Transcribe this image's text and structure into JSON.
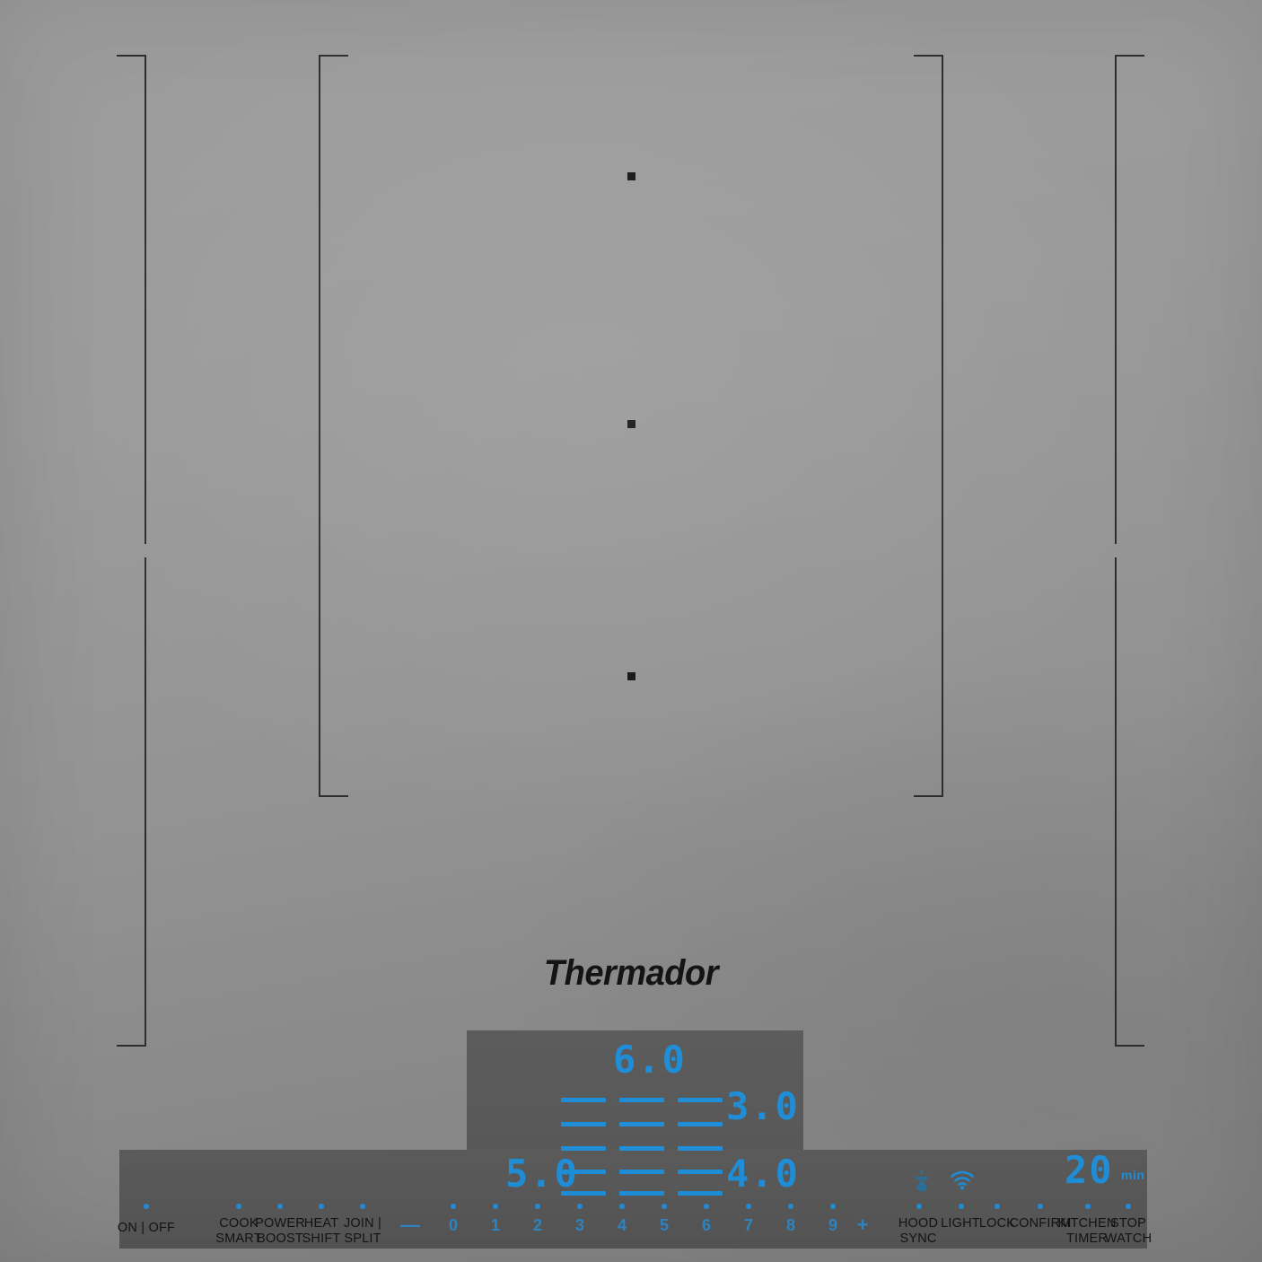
{
  "appliance": {
    "brand": "Thermador",
    "type": "induction-cooktop-control-panel"
  },
  "colors": {
    "glass": "#949494",
    "panel": "#585858",
    "led_blue": "#1f8ed6",
    "led_blue_dim": "#2f6f96",
    "engraving": "#2e2e2e",
    "label_text": "#141414"
  },
  "display": {
    "readouts": [
      {
        "id": "zone-top-center",
        "value": "6.0"
      },
      {
        "id": "zone-right-upper",
        "value": "3.0"
      },
      {
        "id": "zone-left-lower",
        "value": "5.0"
      },
      {
        "id": "zone-right-lower",
        "value": "4.0"
      }
    ],
    "timer": {
      "value": "20",
      "unit": "min"
    }
  },
  "controls": {
    "power": {
      "label": "ON | OFF"
    },
    "functions": [
      {
        "line1": "COOK",
        "line2": "SMART"
      },
      {
        "line1": "POWER",
        "line2": "BOOST"
      },
      {
        "line1": "HEAT",
        "line2": "SHIFT"
      },
      {
        "line1": "JOIN |",
        "line2": "SPLIT"
      }
    ],
    "slider": {
      "minus": "—",
      "digits": [
        "0",
        "1",
        "2",
        "3",
        "4",
        "5",
        "6",
        "7",
        "8",
        "9"
      ],
      "plus": "+"
    },
    "right_functions": [
      {
        "line1": "HOOD",
        "line2": "SYNC",
        "icon": "range-hood-icon"
      },
      {
        "line1": "LIGHT",
        "line2": "",
        "icon": "wifi-icon"
      },
      {
        "line1": "LOCK",
        "line2": ""
      },
      {
        "line1": "CONFIRM",
        "line2": ""
      },
      {
        "line1": "KITCHEN",
        "line2": "TIMER"
      },
      {
        "line1": "STOP",
        "line2": "WATCH"
      }
    ]
  }
}
